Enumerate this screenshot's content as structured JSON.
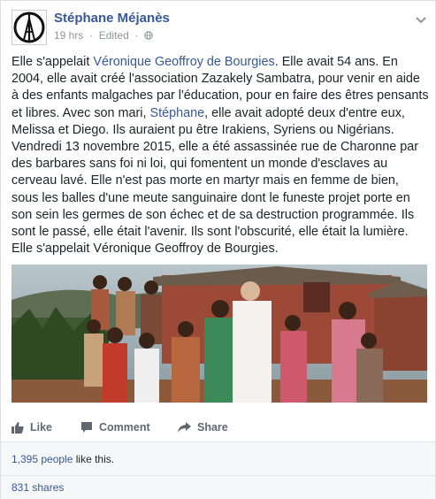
{
  "post": {
    "author": "Stéphane Méjanès",
    "time": "19 hrs",
    "edited": "Edited",
    "text_parts": [
      "Elle s'appelait ",
      "Véronique Geoffroy de Bourgies",
      ". Elle avait 54 ans. En 2004, elle avait créé l'association Zazakely Sambatra, pour venir en aide à des enfants malgaches par l'éducation, pour en faire des êtres pensants et libres. Avec son mari, ",
      "Stéphane",
      ", elle avait adopté deux d'entre eux, Melissa et Diego. Ils auraient pu être Irakiens, Syriens ou Nigérians. Vendredi 13 novembre 2015, elle a été assassinée rue de Charonne par des barbares sans foi ni loi, qui fomentent un monde d'esclaves au cerveau lavé. Elle n'est pas morte en martyr mais en femme de bien, sous les balles d'une meute sanguinaire dont le funeste projet porte en son sein les germes de son échec et de sa destruction programmée. Ils sont le passé, elle était l'avenir. Ils sont l'obscurité, elle était la lumière. Elle s'appelait Véronique Geoffroy de Bourgies."
    ]
  },
  "actions": {
    "like": "Like",
    "comment": "Comment",
    "share": "Share"
  },
  "stats": {
    "likes_count": "1,395 people",
    "likes_suffix": " like this.",
    "shares": "831 shares"
  },
  "icons": {
    "avatar": "peace-for-paris-icon",
    "visibility": "globe-icon",
    "menu": "chevron-down-icon",
    "like": "thumbs-up-icon",
    "comment": "comment-bubble-icon",
    "share": "share-arrow-icon"
  },
  "colors": {
    "link": "#365899",
    "muted": "#90949c",
    "action": "#616770"
  }
}
